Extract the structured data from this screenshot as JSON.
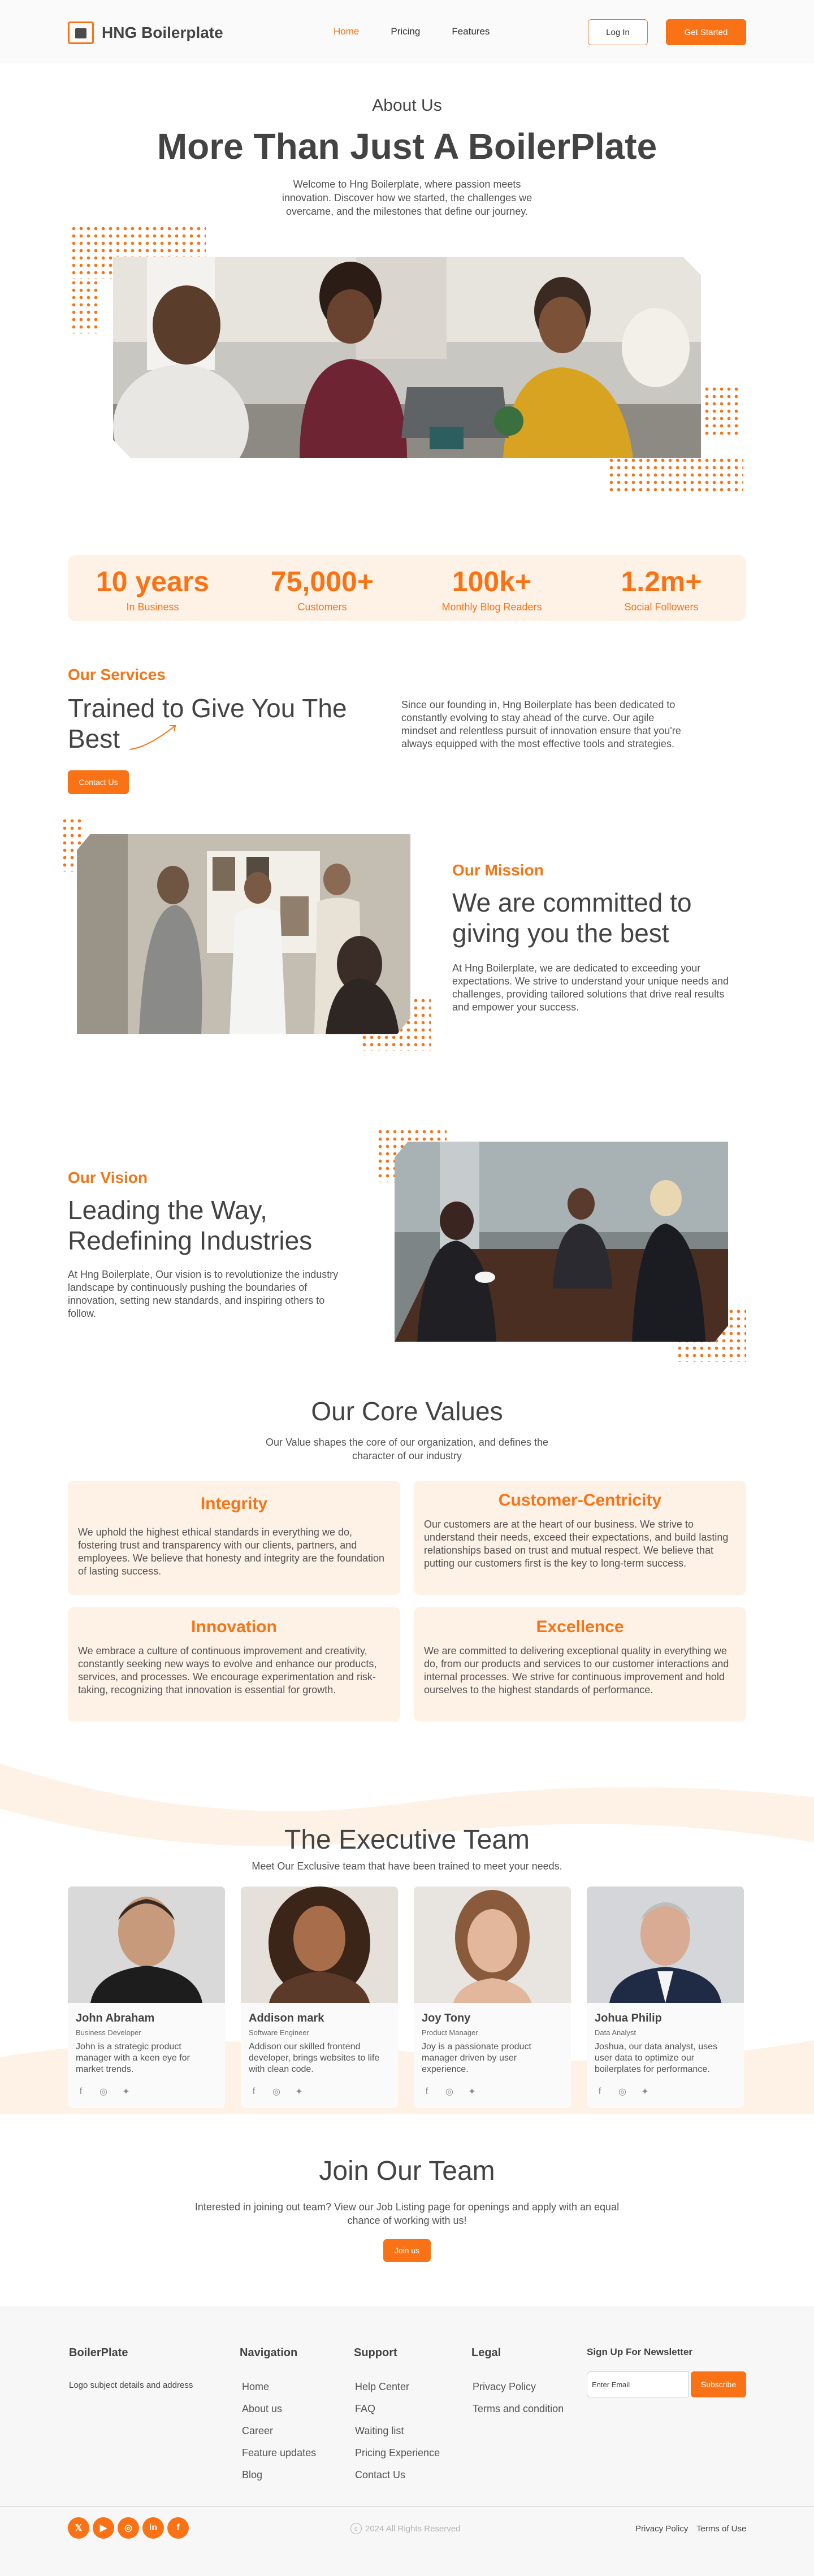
{
  "header": {
    "brand": "HNG Boilerplate",
    "nav": [
      "Home",
      "Pricing",
      "Features"
    ],
    "login_label": "Log In",
    "get_started_label": "Get Started"
  },
  "hero": {
    "eyebrow": "About Us",
    "title": "More Than Just A BoilerPlate",
    "description": "Welcome to Hng Boilerplate, where passion meets innovation. Discover how we started, the challenges we overcame, and the milestones that define our journey."
  },
  "stats": [
    {
      "value": "10 years",
      "label": "In Business"
    },
    {
      "value": "75,000+",
      "label": "Customers"
    },
    {
      "value": "100k+",
      "label": "Monthly Blog Readers"
    },
    {
      "value": "1.2m+",
      "label": "Social Followers"
    }
  ],
  "services": {
    "label": "Our Services",
    "title": "Trained to Give You The Best",
    "text": "Since our founding in, Hng Boilerplate has been dedicated to  constantly evolving to stay ahead of the curve. Our agile mindset and relentless pursuit of innovation ensure that you're always equipped with the most effective tools and strategies.",
    "button_label": "Contact Us"
  },
  "mission": {
    "label": "Our Mission",
    "title": "We are committed to giving you the best",
    "text": "At Hng Boilerplate, we are dedicated to exceeding your expectations. We strive to understand your unique needs and challenges, providing tailored solutions that drive real results and empower your success."
  },
  "vision": {
    "label": "Our Vision",
    "title": "Leading the Way, Redefining Industries",
    "text": "At Hng Boilerplate, Our vision is to revolutionize the industry landscape by continuously pushing the boundaries of innovation, setting new standards, and inspiring others to follow."
  },
  "core_values": {
    "title": "Our Core Values",
    "subtitle": "Our Value shapes the core of our organization, and defines the character of our industry",
    "items": [
      {
        "title": "Integrity",
        "text": "We uphold the highest ethical standards in everything we do, fostering trust and transparency with our clients, partners, and employees. We believe that honesty and integrity are the foundation of lasting success."
      },
      {
        "title": "Customer-Centricity",
        "text": "Our customers are at the heart of our business. We strive to understand their needs, exceed their expectations, and build lasting relationships based on trust and mutual respect. We believe that putting our customers first is the key to long-term success."
      },
      {
        "title": "Innovation",
        "text": "We embrace a culture of continuous improvement and creativity, constantly seeking new ways to evolve and enhance our products, services, and processes. We encourage experimentation and risk-taking, recognizing that innovation is essential for growth."
      },
      {
        "title": "Excellence",
        "text": "We are committed to delivering exceptional quality in everything we do, from our products and services to our customer interactions and internal processes. We strive for continuous improvement and hold ourselves to the highest standards of performance."
      }
    ]
  },
  "team": {
    "title": "The Executive Team",
    "subtitle": "Meet Our Exclusive team that have been trained to meet your needs.",
    "members": [
      {
        "name": "John Abraham",
        "role": "Business Developer",
        "desc": "John is a strategic product manager with a keen eye for market trends."
      },
      {
        "name": "Addison mark",
        "role": "Software Engineer",
        "desc": "Addison our skilled frontend developer, brings websites to life with clean code."
      },
      {
        "name": "Joy Tony",
        "role": "Product Manager",
        "desc": "Joy is a passionate product manager driven by user experience."
      },
      {
        "name": "Johua Philip",
        "role": "Data Analyst",
        "desc": "Joshua, our data analyst, uses user data to optimize our boilerplates for performance."
      }
    ]
  },
  "join": {
    "title": "Join Our Team",
    "text": "Interested in joining out team? View our Job Listing page for openings and apply with an equal chance of working with us!",
    "button_label": "Join us"
  },
  "footer": {
    "brand": "BoilerPlate",
    "brand_desc": "Logo subject details and address",
    "columns": [
      {
        "heading": "Navigation",
        "links": [
          "Home",
          "About us",
          "Career",
          "Feature updates",
          "Blog"
        ]
      },
      {
        "heading": "Support",
        "links": [
          "Help Center",
          "FAQ",
          "Waiting list",
          "Pricing Experience",
          "Contact Us"
        ]
      },
      {
        "heading": "Legal",
        "links": [
          "Privacy Policy",
          "Terms and condition"
        ]
      }
    ],
    "newsletter_heading": "Sign Up For Newsletter",
    "email_placeholder": "Enter Email",
    "subscribe_label": "Subscribe",
    "socials": [
      "x-icon",
      "youtube-icon",
      "instagram-icon",
      "linkedin-icon",
      "facebook-icon"
    ],
    "copyright": "2024 All Rights Reserved",
    "bottom_links": [
      "Privacy Policy",
      "Terms of Use"
    ]
  },
  "colors": {
    "accent": "#F97316",
    "accent_light": "#FEF1E6",
    "text": "#434343"
  }
}
